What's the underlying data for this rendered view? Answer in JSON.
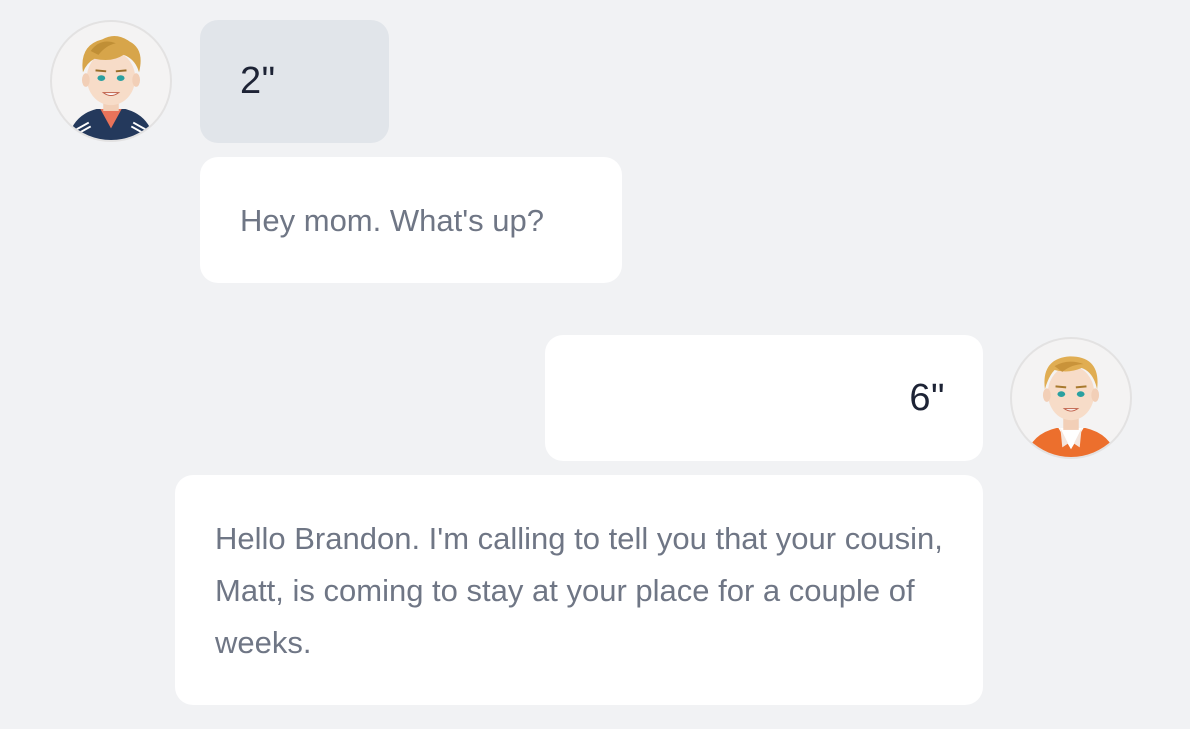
{
  "conversation": {
    "messages": [
      {
        "speaker": "Brandon",
        "duration": "2\"",
        "text": "Hey mom. What's up?",
        "side": "left",
        "avatar_icon": "boy-avatar-icon"
      },
      {
        "speaker": "Mom",
        "duration": "6\"",
        "text": "Hello Brandon. I'm calling to tell you that your cousin, Matt, is coming to stay at your place for a couple of weeks.",
        "side": "right",
        "avatar_icon": "woman-avatar-icon"
      }
    ]
  },
  "colors": {
    "background": "#f1f2f4",
    "bubble": "#ffffff",
    "duration_bubble_active": "#e1e5ea",
    "duration_text": "#1d2335",
    "message_text": "#6f7685"
  }
}
